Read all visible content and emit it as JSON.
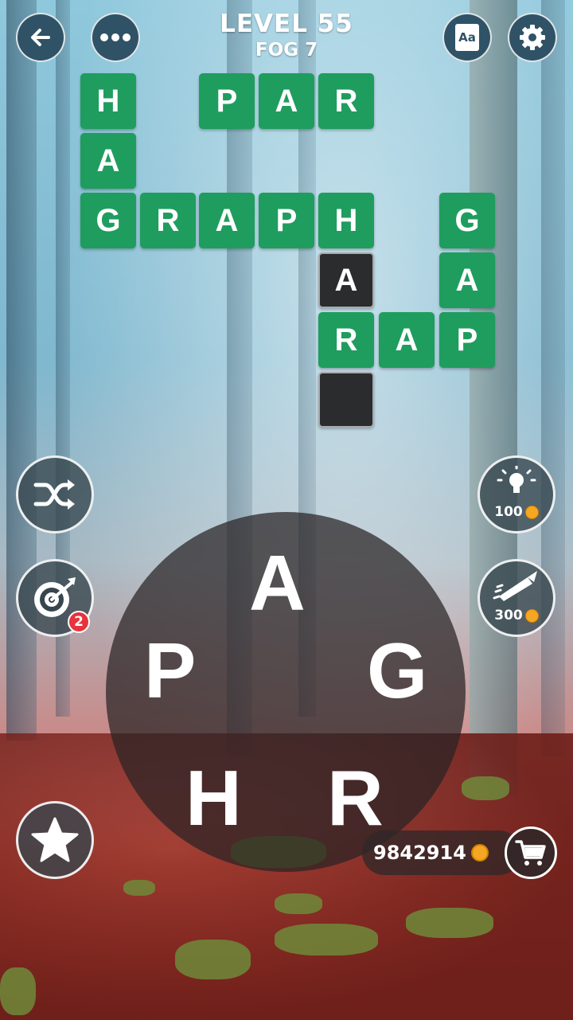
{
  "header": {
    "level": "LEVEL 55",
    "pack": "FOG 7"
  },
  "grid": {
    "tiles": [
      "H",
      "P",
      "A",
      "R",
      "A",
      "G",
      "R",
      "A",
      "P",
      "H",
      "G",
      "A",
      "A",
      "R",
      "A",
      "P"
    ],
    "hidden_count": 1
  },
  "wheel": {
    "letters": [
      "A",
      "P",
      "G",
      "H",
      "R"
    ]
  },
  "hints": {
    "bulb_cost": "100",
    "rocket_cost": "300",
    "target_badge": "2"
  },
  "wallet": {
    "coins": "9842914"
  },
  "colors": {
    "tile": "#1f9d5e",
    "accent_coin": "#f5a623",
    "badge": "#e8323c"
  },
  "icons": [
    "back-arrow-icon",
    "more-dots-icon",
    "dictionary-icon",
    "gear-icon",
    "shuffle-icon",
    "target-icon",
    "lightbulb-icon",
    "rocket-icon",
    "star-icon",
    "cart-icon"
  ]
}
